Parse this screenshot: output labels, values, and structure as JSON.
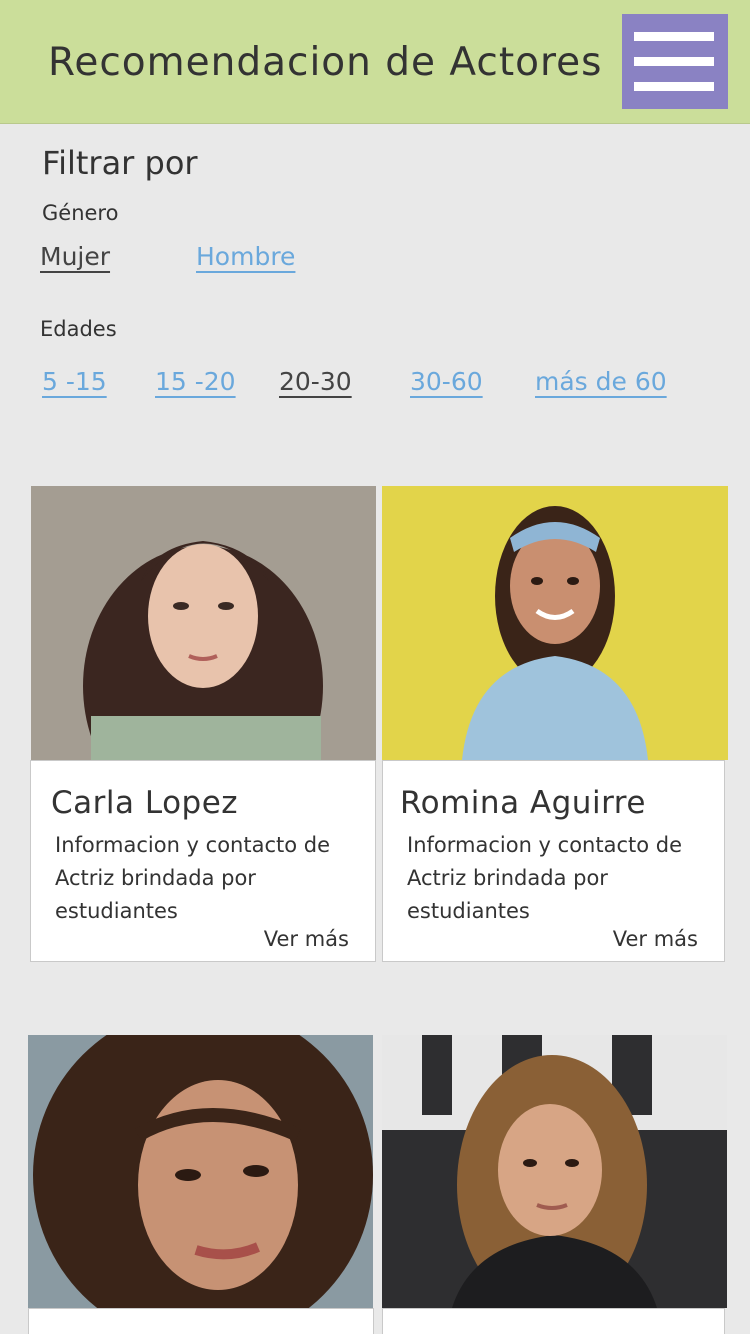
{
  "header": {
    "title": "Recomendacion de Actores",
    "menu_icon": "hamburger-menu-icon"
  },
  "filters": {
    "title": "Filtrar por",
    "gender": {
      "label": "Género",
      "options": [
        "Mujer",
        "Hombre"
      ],
      "selected": "Mujer"
    },
    "ages": {
      "label": "Edades",
      "options": [
        "5 -15",
        "15 -20",
        "20-30",
        "30-60",
        "más de 60"
      ],
      "selected": "20-30"
    }
  },
  "cards": [
    {
      "name": "Carla Lopez",
      "description": "Informacion y contacto de Actriz brindada por estudiantes",
      "more": "Ver más"
    },
    {
      "name": "Romina Aguirre",
      "description": "Informacion y contacto de Actriz brindada por estudiantes",
      "more": "Ver más"
    },
    {
      "name": "",
      "description": "",
      "more": ""
    },
    {
      "name": "",
      "description": "",
      "more": ""
    }
  ],
  "colors": {
    "header_bg": "#cbde9a",
    "menu_bg": "#8a82c3",
    "link_inactive": "#6aa8dc",
    "link_active": "#444444",
    "page_bg": "#e9e9e9"
  }
}
